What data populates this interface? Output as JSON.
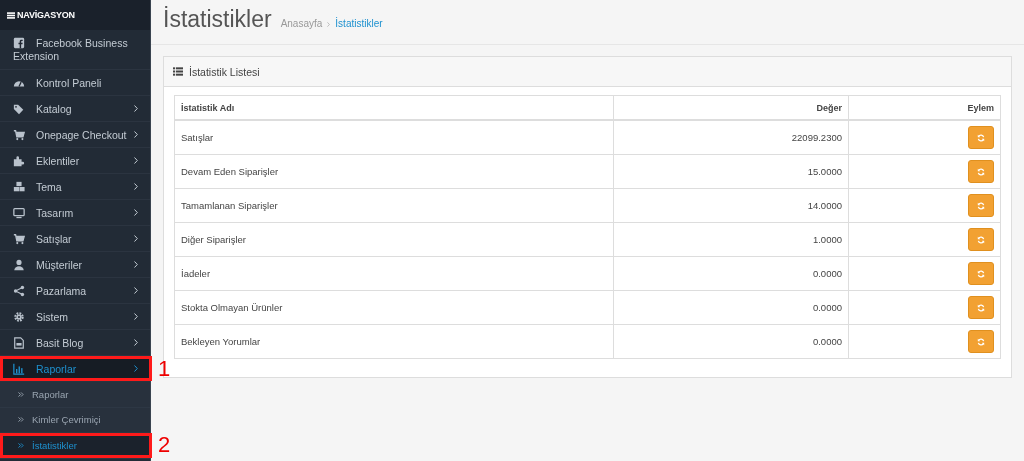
{
  "sidebar": {
    "title": "NAVİGASYON",
    "items": [
      {
        "kind": "facebook",
        "label": "Facebook Business Extension",
        "arrow": false,
        "selected": false
      },
      {
        "kind": "dashboard",
        "label": "Kontrol Paneli",
        "arrow": false,
        "selected": false
      },
      {
        "kind": "tags",
        "label": "Katalog",
        "arrow": true,
        "selected": false
      },
      {
        "kind": "cart",
        "label": "Onepage Checkout",
        "arrow": true,
        "selected": false
      },
      {
        "kind": "puzzle",
        "label": "Eklentiler",
        "arrow": true,
        "selected": false
      },
      {
        "kind": "cubes",
        "label": "Tema",
        "arrow": true,
        "selected": false
      },
      {
        "kind": "monitor",
        "label": "Tasarım",
        "arrow": true,
        "selected": false
      },
      {
        "kind": "cart",
        "label": "Satışlar",
        "arrow": true,
        "selected": false
      },
      {
        "kind": "user",
        "label": "Müşteriler",
        "arrow": true,
        "selected": false
      },
      {
        "kind": "share",
        "label": "Pazarlama",
        "arrow": true,
        "selected": false
      },
      {
        "kind": "gear",
        "label": "Sistem",
        "arrow": true,
        "selected": false
      },
      {
        "kind": "file",
        "label": "Basit Blog",
        "arrow": true,
        "selected": false
      },
      {
        "kind": "chart",
        "label": "Raporlar",
        "arrow": true,
        "selected": true,
        "annotation": "1",
        "children": [
          {
            "label": "Raporlar",
            "selected": false
          },
          {
            "label": "Kimler Çevrimiçi",
            "selected": false
          },
          {
            "label": "İstatistikler",
            "selected": true,
            "annotation": "2"
          }
        ]
      }
    ]
  },
  "page": {
    "title": "İstatistikler",
    "breadcrumb": [
      {
        "label": "Anasayfa",
        "current": false
      },
      {
        "label": "İstatistikler",
        "current": true
      }
    ]
  },
  "panel": {
    "title": "İstatistik Listesi",
    "table": {
      "columns": [
        "İstatistik Adı",
        "Değer",
        "Eylem"
      ],
      "rows": [
        {
          "name": "Satışlar",
          "value": "22099.2300"
        },
        {
          "name": "Devam Eden Siparişler",
          "value": "15.0000"
        },
        {
          "name": "Tamamlanan Siparişler",
          "value": "14.0000"
        },
        {
          "name": "Diğer Siparişler",
          "value": "1.0000"
        },
        {
          "name": "İadeler",
          "value": "0.0000"
        },
        {
          "name": "Stokta Olmayan Ürünler",
          "value": "0.0000"
        },
        {
          "name": "Bekleyen Yorumlar",
          "value": "0.0000"
        }
      ]
    }
  }
}
